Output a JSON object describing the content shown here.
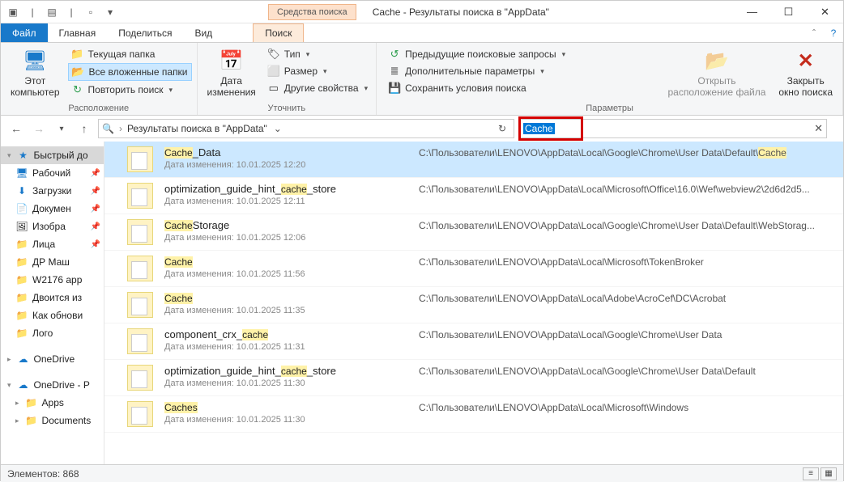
{
  "window": {
    "tools_tab": "Средства поиска",
    "title": "Cache - Результаты поиска в \"AppData\""
  },
  "tabs": {
    "file": "Файл",
    "home": "Главная",
    "share": "Поделиться",
    "view": "Вид",
    "search": "Поиск"
  },
  "ribbon": {
    "g1": {
      "this_pc": "Этот\nкомпьютер",
      "current_folder": "Текущая папка",
      "all_subfolders": "Все вложенные папки",
      "search_again": "Повторить поиск ",
      "label": "Расположение"
    },
    "g2": {
      "date": "Дата\nизменения",
      "type": "Тип ",
      "size": "Размер ",
      "other": "Другие свойства ",
      "label": "Уточнить"
    },
    "g3": {
      "recent": "Предыдущие поисковые запросы ",
      "advanced": "Дополнительные параметры ",
      "save": "Сохранить условия поиска",
      "label": "Параметры"
    },
    "g4": {
      "open_loc": "Открыть\nрасположение файла",
      "close": "Закрыть\nокно поиска"
    }
  },
  "address": {
    "crumb": "Результаты поиска в \"AppData\"",
    "search_term": "Cache"
  },
  "nav": {
    "quick": "Быстрый до",
    "desktop": "Рабочий",
    "downloads": "Загрузки",
    "documents": "Докумен",
    "pictures": "Изобра",
    "faces": "Лица",
    "dr": "ДР Маш",
    "w2176": "W2176 app",
    "dvoitsa": "Двоится из",
    "kakobn": "Как обнови",
    "logo": "Лого",
    "onedrive": "OneDrive",
    "onedrivep": "OneDrive - P",
    "apps": "Apps",
    "documents2": "Documents"
  },
  "results": [
    {
      "name_pre": "",
      "name_hl": "Cache",
      "name_post": "_Data",
      "date": "Дата изменения: 10.01.2025 12:20",
      "path_pre": "C:\\Пользователи\\LENOVO\\AppData\\Local\\Google\\Chrome\\User Data\\Default\\",
      "path_hl": "Cache",
      "path_post": "",
      "sel": true
    },
    {
      "name_pre": "optimization_guide_hint_",
      "name_hl": "cache",
      "name_post": "_store",
      "date": "Дата изменения: 10.01.2025 12:11",
      "path_pre": "C:\\Пользователи\\LENOVO\\AppData\\Local\\Microsoft\\Office\\16.0\\Wef\\webview2\\2d6d2d5...",
      "path_hl": "",
      "path_post": ""
    },
    {
      "name_pre": "",
      "name_hl": "Cache",
      "name_post": "Storage",
      "date": "Дата изменения: 10.01.2025 12:06",
      "path_pre": "C:\\Пользователи\\LENOVO\\AppData\\Local\\Google\\Chrome\\User Data\\Default\\WebStorag...",
      "path_hl": "",
      "path_post": ""
    },
    {
      "name_pre": "",
      "name_hl": "Cache",
      "name_post": "",
      "date": "Дата изменения: 10.01.2025 11:56",
      "path_pre": "C:\\Пользователи\\LENOVO\\AppData\\Local\\Microsoft\\TokenBroker",
      "path_hl": "",
      "path_post": ""
    },
    {
      "name_pre": "",
      "name_hl": "Cache",
      "name_post": "",
      "date": "Дата изменения: 10.01.2025 11:35",
      "path_pre": "C:\\Пользователи\\LENOVO\\AppData\\Local\\Adobe\\AcroCef\\DC\\Acrobat",
      "path_hl": "",
      "path_post": ""
    },
    {
      "name_pre": "component_crx_",
      "name_hl": "cache",
      "name_post": "",
      "date": "Дата изменения: 10.01.2025 11:31",
      "path_pre": "C:\\Пользователи\\LENOVO\\AppData\\Local\\Google\\Chrome\\User Data",
      "path_hl": "",
      "path_post": ""
    },
    {
      "name_pre": "optimization_guide_hint_",
      "name_hl": "cache",
      "name_post": "_store",
      "date": "Дата изменения: 10.01.2025 11:30",
      "path_pre": "C:\\Пользователи\\LENOVO\\AppData\\Local\\Google\\Chrome\\User Data\\Default",
      "path_hl": "",
      "path_post": ""
    },
    {
      "name_pre": "",
      "name_hl": "Caches",
      "name_post": "",
      "date": "Дата изменения: 10.01.2025 11:30",
      "path_pre": "C:\\Пользователи\\LENOVO\\AppData\\Local\\Microsoft\\Windows",
      "path_hl": "",
      "path_post": ""
    }
  ],
  "status": {
    "count_label": "Элементов: 868"
  }
}
